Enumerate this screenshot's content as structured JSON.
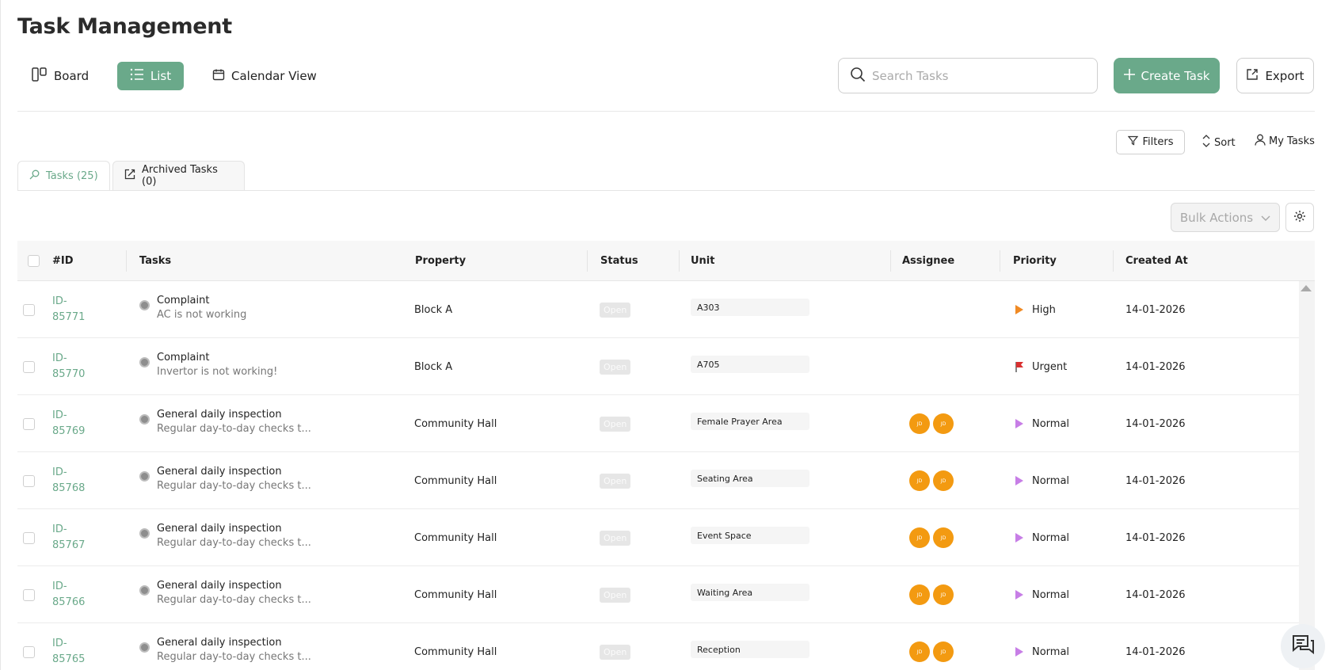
{
  "page": {
    "title": "Task Management"
  },
  "views": [
    {
      "label": "Board",
      "icon": "board-icon",
      "active": false
    },
    {
      "label": "List",
      "icon": "list-icon",
      "active": true
    },
    {
      "label": "Calendar View",
      "icon": "calendar-icon",
      "active": false
    }
  ],
  "search": {
    "placeholder": "Search Tasks",
    "value": ""
  },
  "actions": {
    "create_label": "Create Task",
    "export_label": "Export"
  },
  "toolbar": {
    "filters_label": "Filters",
    "sort_label": "Sort",
    "my_tasks_label": "My Tasks"
  },
  "tabs": [
    {
      "label": "Tasks (25)",
      "active": true
    },
    {
      "label": "Archived Tasks (0)",
      "active": false
    }
  ],
  "bulk_actions_label": "Bulk Actions",
  "columns": [
    "#ID",
    "Tasks",
    "Property",
    "Status",
    "Unit",
    "Assignee",
    "Priority",
    "Created At"
  ],
  "rows": [
    {
      "id_prefix": "ID-",
      "id_num": "85771",
      "task": "Complaint",
      "desc": "AC is not working",
      "property": "Block A",
      "status": "Open",
      "unit": "A303",
      "assignees": [],
      "priority": "High",
      "created": "14-01-2026"
    },
    {
      "id_prefix": "ID-",
      "id_num": "85770",
      "task": "Complaint",
      "desc": "Invertor is not working!",
      "property": "Block A",
      "status": "Open",
      "unit": "A705",
      "assignees": [],
      "priority": "Urgent",
      "created": "14-01-2026"
    },
    {
      "id_prefix": "ID-",
      "id_num": "85769",
      "task": "General daily inspection",
      "desc": "Regular day-to-day checks t...",
      "property": "Community Hall",
      "status": "Open",
      "unit": "Female Prayer Area",
      "assignees": [
        "JD",
        "JD"
      ],
      "priority": "Normal",
      "created": "14-01-2026"
    },
    {
      "id_prefix": "ID-",
      "id_num": "85768",
      "task": "General daily inspection",
      "desc": "Regular day-to-day checks t...",
      "property": "Community Hall",
      "status": "Open",
      "unit": "Seating Area",
      "assignees": [
        "JD",
        "JD"
      ],
      "priority": "Normal",
      "created": "14-01-2026"
    },
    {
      "id_prefix": "ID-",
      "id_num": "85767",
      "task": "General daily inspection",
      "desc": "Regular day-to-day checks t...",
      "property": "Community Hall",
      "status": "Open",
      "unit": "Event Space",
      "assignees": [
        "JD",
        "JD"
      ],
      "priority": "Normal",
      "created": "14-01-2026"
    },
    {
      "id_prefix": "ID-",
      "id_num": "85766",
      "task": "General daily inspection",
      "desc": "Regular day-to-day checks t...",
      "property": "Community Hall",
      "status": "Open",
      "unit": "Waiting Area",
      "assignees": [
        "JD",
        "JD"
      ],
      "priority": "Normal",
      "created": "14-01-2026"
    },
    {
      "id_prefix": "ID-",
      "id_num": "85765",
      "task": "General daily inspection",
      "desc": "Regular day-to-day checks t...",
      "property": "Community Hall",
      "status": "Open",
      "unit": "Reception",
      "assignees": [
        "JD",
        "JD"
      ],
      "priority": "Normal",
      "created": "14-01-2026"
    }
  ],
  "priority_colors": {
    "High": "#f08a24",
    "Urgent": "#d93030",
    "Normal": "#c77ee6"
  },
  "colors": {
    "accent": "#6aa98a",
    "avatar": "#f39a11"
  }
}
